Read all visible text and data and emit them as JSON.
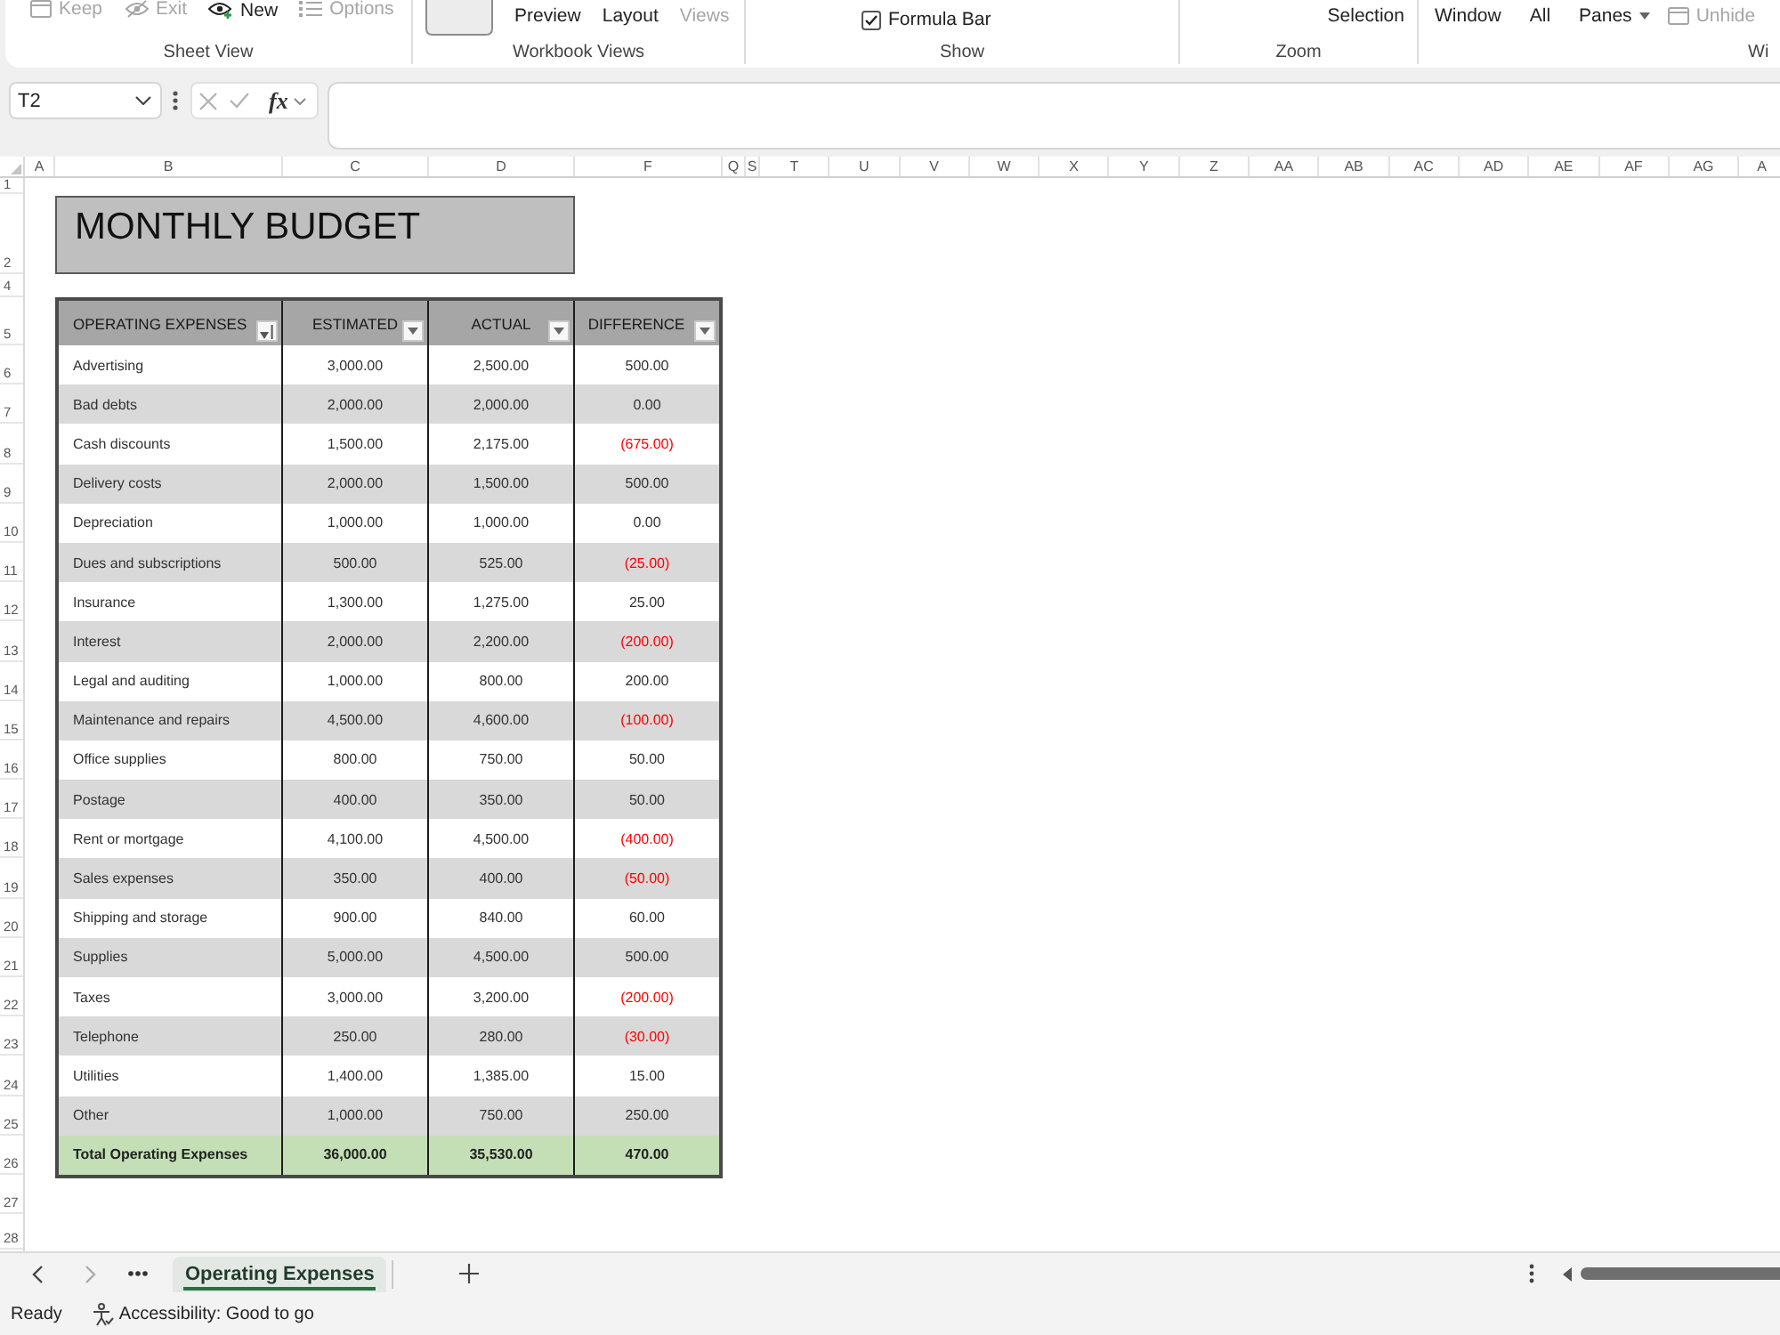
{
  "ribbon": {
    "groups": [
      {
        "label": "Sheet View",
        "items": [
          {
            "kind": "icon",
            "label": "Keep",
            "disabled": true
          },
          {
            "kind": "icon",
            "label": "Exit",
            "disabled": true
          },
          {
            "kind": "icon",
            "label": "New",
            "disabled": false
          },
          {
            "kind": "icon",
            "label": "Options",
            "disabled": true
          }
        ]
      },
      {
        "label": "Workbook Views",
        "items": [
          {
            "kind": "tile"
          },
          {
            "kind": "text",
            "label": "Preview",
            "disabled": false
          },
          {
            "kind": "text",
            "label": "Layout",
            "disabled": false
          },
          {
            "kind": "text",
            "label": "Views",
            "disabled": true
          }
        ]
      },
      {
        "label": "Show",
        "items": [
          {
            "kind": "check",
            "label": "Formula Bar",
            "checked": true,
            "disabled": false
          }
        ]
      },
      {
        "label": "Zoom",
        "items": [
          {
            "kind": "text",
            "label": "Selection",
            "disabled": false
          }
        ]
      },
      {
        "label": "Wi",
        "items": [
          {
            "kind": "text",
            "label": "Window",
            "disabled": false
          },
          {
            "kind": "text",
            "label": "All",
            "disabled": false
          },
          {
            "kind": "menu",
            "label": "Panes",
            "disabled": false
          },
          {
            "kind": "icon",
            "label": "Unhide",
            "disabled": true
          }
        ]
      }
    ]
  },
  "formula_bar": {
    "name_box": "T2",
    "function_button": "fx"
  },
  "columns": [
    "A",
    "B",
    "C",
    "D",
    "F",
    "Q",
    "S",
    "T",
    "U",
    "V",
    "W",
    "X",
    "Y",
    "Z",
    "AA",
    "AB",
    "AC",
    "AD",
    "AE",
    "AF",
    "AG",
    "A"
  ],
  "rows": [
    "1",
    "2",
    "4",
    "5",
    "6",
    "7",
    "8",
    "9",
    "10",
    "11",
    "12",
    "13",
    "14",
    "15",
    "16",
    "17",
    "18",
    "19",
    "20",
    "21",
    "22",
    "23",
    "24",
    "25",
    "26",
    "27",
    "28"
  ],
  "title": "MONTHLY BUDGET",
  "table": {
    "columns": [
      {
        "label": "OPERATING EXPENSES",
        "sorted": true
      },
      {
        "label": "ESTIMATED",
        "sorted": false
      },
      {
        "label": "ACTUAL",
        "sorted": false
      },
      {
        "label": "DIFFERENCE",
        "sorted": false
      }
    ],
    "rows": [
      {
        "expense": "Advertising",
        "estimated": "3,000.00",
        "actual": "2,500.00",
        "difference": "500.00",
        "negative": false
      },
      {
        "expense": "Bad debts",
        "estimated": "2,000.00",
        "actual": "2,000.00",
        "difference": "0.00",
        "negative": false
      },
      {
        "expense": "Cash discounts",
        "estimated": "1,500.00",
        "actual": "2,175.00",
        "difference": "(675.00)",
        "negative": true
      },
      {
        "expense": "Delivery costs",
        "estimated": "2,000.00",
        "actual": "1,500.00",
        "difference": "500.00",
        "negative": false
      },
      {
        "expense": "Depreciation",
        "estimated": "1,000.00",
        "actual": "1,000.00",
        "difference": "0.00",
        "negative": false
      },
      {
        "expense": "Dues and subscriptions",
        "estimated": "500.00",
        "actual": "525.00",
        "difference": "(25.00)",
        "negative": true
      },
      {
        "expense": "Insurance",
        "estimated": "1,300.00",
        "actual": "1,275.00",
        "difference": "25.00",
        "negative": false
      },
      {
        "expense": "Interest",
        "estimated": "2,000.00",
        "actual": "2,200.00",
        "difference": "(200.00)",
        "negative": true
      },
      {
        "expense": "Legal and auditing",
        "estimated": "1,000.00",
        "actual": "800.00",
        "difference": "200.00",
        "negative": false
      },
      {
        "expense": "Maintenance and repairs",
        "estimated": "4,500.00",
        "actual": "4,600.00",
        "difference": "(100.00)",
        "negative": true
      },
      {
        "expense": "Office supplies",
        "estimated": "800.00",
        "actual": "750.00",
        "difference": "50.00",
        "negative": false
      },
      {
        "expense": "Postage",
        "estimated": "400.00",
        "actual": "350.00",
        "difference": "50.00",
        "negative": false
      },
      {
        "expense": "Rent or mortgage",
        "estimated": "4,100.00",
        "actual": "4,500.00",
        "difference": "(400.00)",
        "negative": true
      },
      {
        "expense": "Sales expenses",
        "estimated": "350.00",
        "actual": "400.00",
        "difference": "(50.00)",
        "negative": true
      },
      {
        "expense": "Shipping and storage",
        "estimated": "900.00",
        "actual": "840.00",
        "difference": "60.00",
        "negative": false
      },
      {
        "expense": "Supplies",
        "estimated": "5,000.00",
        "actual": "4,500.00",
        "difference": "500.00",
        "negative": false
      },
      {
        "expense": "Taxes",
        "estimated": "3,000.00",
        "actual": "3,200.00",
        "difference": "(200.00)",
        "negative": true
      },
      {
        "expense": "Telephone",
        "estimated": "250.00",
        "actual": "280.00",
        "difference": "(30.00)",
        "negative": true
      },
      {
        "expense": "Utilities",
        "estimated": "1,400.00",
        "actual": "1,385.00",
        "difference": "15.00",
        "negative": false
      },
      {
        "expense": "Other",
        "estimated": "1,000.00",
        "actual": "750.00",
        "difference": "250.00",
        "negative": false
      }
    ],
    "total": {
      "label": "Total Operating Expenses",
      "estimated": "36,000.00",
      "actual": "35,530.00",
      "difference": "470.00"
    }
  },
  "sheet_tabs": [
    {
      "label": "Operating Expenses",
      "selected": true
    }
  ],
  "status_bar": {
    "mode": "Ready",
    "accessibility": "Accessibility: Good to go"
  }
}
